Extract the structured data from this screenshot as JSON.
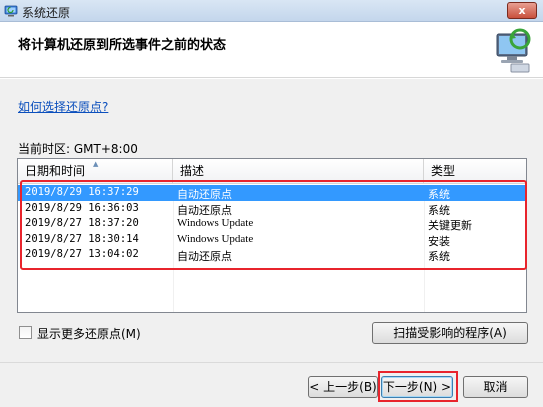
{
  "window": {
    "title": "系统还原",
    "close_label": "x"
  },
  "header": {
    "heading": "将计算机还原到所选事件之前的状态"
  },
  "help_link": "如何选择还原点?",
  "timezone": "当前时区: GMT+8:00",
  "table": {
    "columns": [
      "日期和时间",
      "描述",
      "类型"
    ],
    "rows": [
      {
        "datetime": "2019/8/29 16:37:29",
        "description": "自动还原点",
        "type": "系统",
        "selected": true
      },
      {
        "datetime": "2019/8/29 16:36:03",
        "description": "自动还原点",
        "type": "系统"
      },
      {
        "datetime": "2019/8/27 18:37:20",
        "description": "Windows Update",
        "type": "关键更新"
      },
      {
        "datetime": "2019/8/27 18:30:14",
        "description": "Windows Update",
        "type": "安装"
      },
      {
        "datetime": "2019/8/27 13:04:02",
        "description": "自动还原点",
        "type": "系统"
      }
    ]
  },
  "show_more_label": "显示更多还原点(M)",
  "buttons": {
    "scan": "扫描受影响的程序(A)",
    "prev": "< 上一步(B)",
    "next": "下一步(N) >",
    "cancel": "取消"
  },
  "colors": {
    "selection": "#3399ff",
    "highlight_box": "#e8242c",
    "link": "#0b4fbd"
  }
}
